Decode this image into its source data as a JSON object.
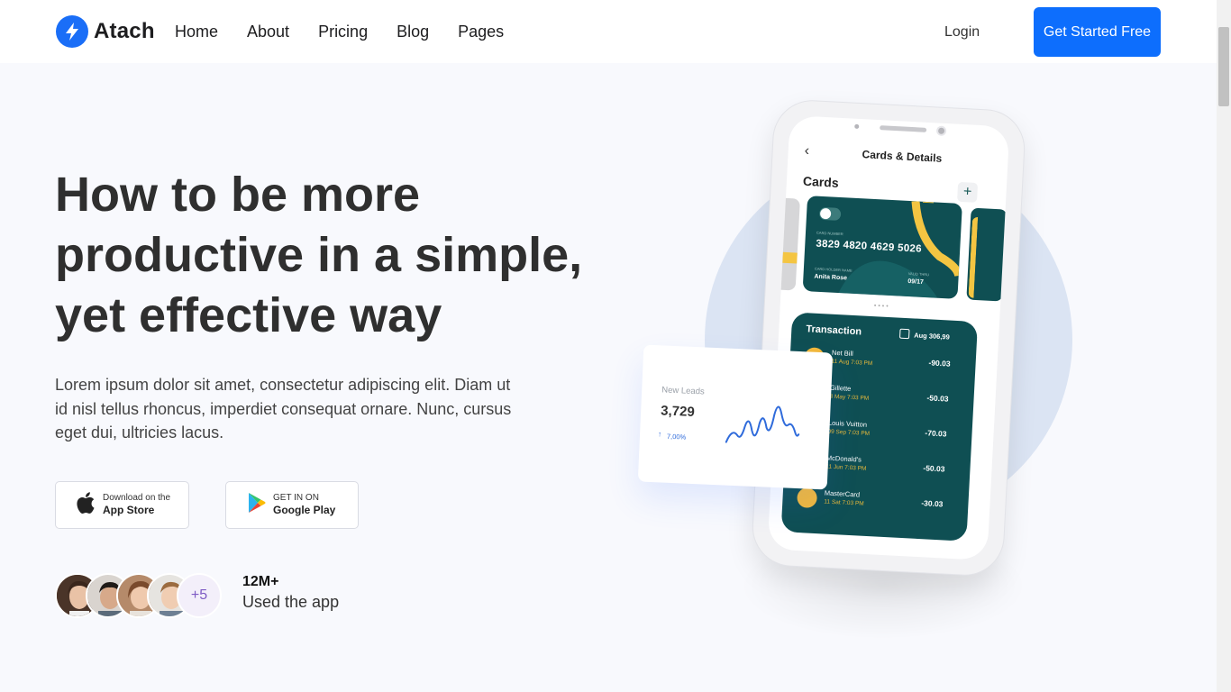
{
  "brand": {
    "name": "Atach",
    "accent": "#0d6efd"
  },
  "nav": {
    "items": [
      "Home",
      "About",
      "Pricing",
      "Blog",
      "Pages"
    ],
    "login": "Login",
    "cta": "Get Started Free"
  },
  "hero": {
    "title": "How to be more productive in a simple, yet effective way",
    "description": "Lorem ipsum dolor sit amet, consectetur adipiscing elit. Diam ut id nisl tellus rhoncus, imperdiet consequat ornare. Nunc, cursus eget dui, ultricies lacus.",
    "app_store": {
      "small": "Download on the",
      "big": "App Store"
    },
    "google_play": {
      "small": "GET IN ON",
      "big": "Google Play"
    },
    "avatars_more": "+5",
    "users_count": "12M+",
    "users_label": "Used the app"
  },
  "phone": {
    "back_icon": "chevron-left-icon",
    "screen_title": "Cards & Details",
    "cards_heading": "Cards",
    "add_button": "+",
    "card": {
      "number": "3829 4820 4629 5026",
      "number_label": "Card Number",
      "holder_label": "Card Holder Name",
      "holder": "Anita Rose",
      "expiry_label": "Valid Thru",
      "expiry": "09/17"
    },
    "transaction": {
      "title": "Transaction",
      "date": "Aug 306,99",
      "rows": [
        {
          "name": "Net Bill",
          "sub": "11 Aug  7:03 PM",
          "amount": "-90.03",
          "color": "#f4b93a"
        },
        {
          "name": "Gillette",
          "sub": "3 May  7:03 PM",
          "amount": "-50.03",
          "color": "#e9effb"
        },
        {
          "name": "Louis Vuitton",
          "sub": "09 Sep 7:03 PM",
          "amount": "-70.03",
          "color": "#9a86e8"
        },
        {
          "name": "McDonald's",
          "sub": "11 Jun  7:03 PM",
          "amount": "-50.03",
          "color": "#f4b93a"
        },
        {
          "name": "MasterCard",
          "sub": "11 Sat  7:03 PM",
          "amount": "-30.03",
          "color": "#f4b93a"
        }
      ]
    }
  },
  "leads": {
    "label": "New Leads",
    "value": "3,729",
    "change": "7,00%"
  }
}
